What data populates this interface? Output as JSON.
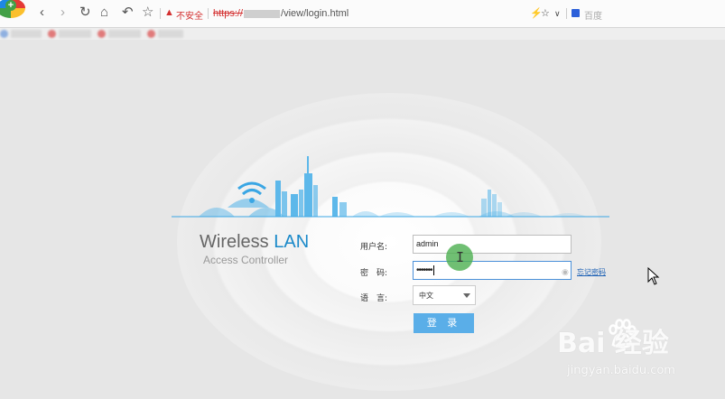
{
  "browser": {
    "security_warning": "不安全",
    "url": {
      "scheme": "https://",
      "path": "/view/login.html"
    },
    "search_placeholder": "百度"
  },
  "login": {
    "brand_word": "Wireless",
    "brand_accent": "LAN",
    "brand_sub": "Access Controller",
    "username_label": "用户名:",
    "username_value": "admin",
    "password_label": "密　码:",
    "password_value": "•••••••",
    "forgot_link": "忘记密码",
    "language_label": "语　言:",
    "language_value": "中文",
    "login_button": "登 录"
  },
  "watermark": {
    "main": "Bai 经验",
    "sub": "jingyan.baidu.com"
  },
  "colors": {
    "accent": "#1a89c9",
    "button": "#5aaee8",
    "warning": "#d32f2f"
  }
}
